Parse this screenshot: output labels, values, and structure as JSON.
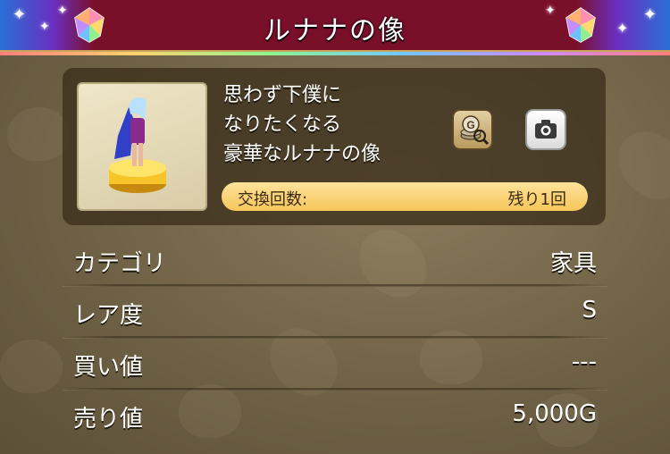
{
  "title": "ルナナの像",
  "item": {
    "description_lines": [
      "思わず下僕に",
      "なりたくなる",
      "豪華なルナナの像"
    ],
    "exchange_label": "交換回数:",
    "exchange_value": "残り1回"
  },
  "stats": [
    {
      "label": "カテゴリ",
      "value": "家具"
    },
    {
      "label": "レア度",
      "value": "S"
    },
    {
      "label": "買い値",
      "value": "---"
    },
    {
      "label": "売り値",
      "value": "5,000G"
    }
  ],
  "icons": {
    "shop_button": "gold-coin-search-icon",
    "camera_button": "camera-icon"
  },
  "colors": {
    "title_bar": "#7a0f2a",
    "exchange_pill": "#f5c65a",
    "background": "#6f6246"
  }
}
